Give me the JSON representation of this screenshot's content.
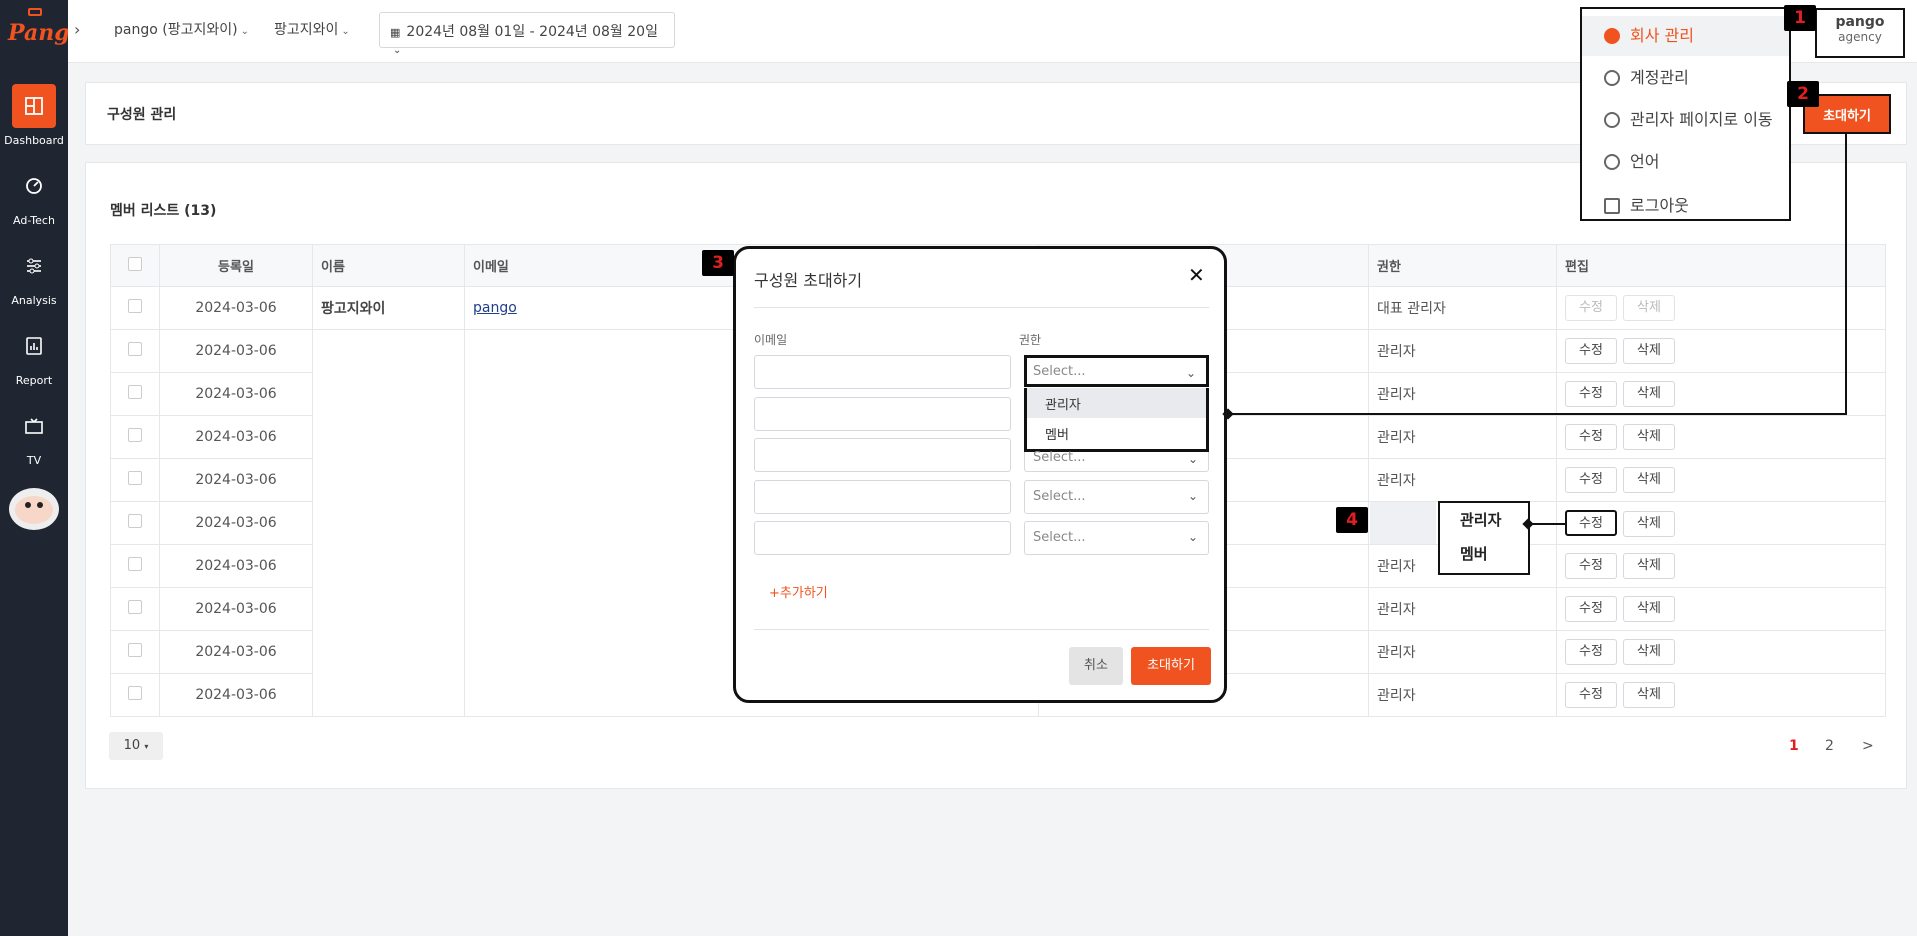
{
  "sidebar": {
    "logo": "Pango",
    "items": [
      {
        "label": "Dashboard",
        "icon": "dashboard-icon"
      },
      {
        "label": "Ad-Tech",
        "icon": "adtech-icon"
      },
      {
        "label": "Analysis",
        "icon": "analysis-icon"
      },
      {
        "label": "Report",
        "icon": "report-icon"
      },
      {
        "label": "TV",
        "icon": "tv-icon"
      }
    ]
  },
  "topbar": {
    "expand": "›",
    "org_select": "pango (팡고지와이)",
    "brand_select": "팡고지와이",
    "date_range": "2024년 08월 01일 - 2024년 08월 20일",
    "profile_name": "pango",
    "profile_role": "agency"
  },
  "user_menu": {
    "back": "‹",
    "items": [
      "회사 관리",
      "계정관리",
      "관리자 페이지로 이동",
      "언어",
      "로그아웃"
    ]
  },
  "page": {
    "title": "구성원 관리",
    "invite_button": "초대하기",
    "list_title": "멤버 리스트 (13)"
  },
  "table": {
    "headers": [
      "등록일",
      "이름",
      "이메일",
      "권한",
      "편집"
    ],
    "edit_label": "수정",
    "delete_label": "삭제",
    "rows": [
      {
        "date": "2024-03-06",
        "name": "팡고지와이",
        "email": "pango",
        "role": "대표 관리자",
        "disabled": true
      },
      {
        "date": "2024-03-06",
        "name": "",
        "email": "",
        "role": "관리자",
        "disabled": false
      },
      {
        "date": "2024-03-06",
        "name": "",
        "email": "",
        "role": "관리자",
        "disabled": false
      },
      {
        "date": "2024-03-06",
        "name": "",
        "email": "",
        "role": "관리자",
        "disabled": false
      },
      {
        "date": "2024-03-06",
        "name": "",
        "email": "",
        "role": "관리자",
        "disabled": false
      },
      {
        "date": "2024-03-06",
        "name": "",
        "email": "",
        "role": "관리자",
        "disabled": false
      },
      {
        "date": "2024-03-06",
        "name": "",
        "email": "",
        "role": "관리자",
        "disabled": false
      },
      {
        "date": "2024-03-06",
        "name": "",
        "email": "",
        "role": "관리자",
        "disabled": false
      },
      {
        "date": "2024-03-06",
        "name": "",
        "email": "",
        "role": "관리자",
        "disabled": false
      },
      {
        "date": "2024-03-06",
        "name": "",
        "email": "",
        "role": "관리자",
        "disabled": false
      }
    ]
  },
  "pagination": {
    "page_size": "10",
    "pages": [
      "1",
      "2"
    ],
    "next": ">"
  },
  "modal": {
    "title": "구성원 초대하기",
    "close": "✕",
    "email_label": "이메일",
    "role_label": "권한",
    "select_placeholder": "Select...",
    "options": [
      "관리자",
      "멤버"
    ],
    "add_more": "+추가하기",
    "cancel": "취소",
    "submit": "초대하기"
  },
  "role_popup": {
    "options": [
      "관리자",
      "멤버"
    ]
  },
  "annotations": [
    "1",
    "2",
    "3",
    "4"
  ],
  "colors": {
    "accent": "#f0531f",
    "sidebar": "#1f2631",
    "annotation_text": "#e02020"
  }
}
